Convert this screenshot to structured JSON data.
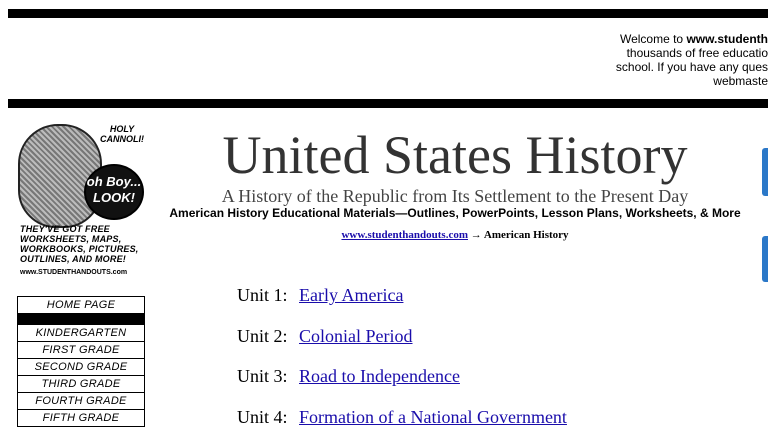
{
  "welcome": {
    "line1_prefix": "Welcome to ",
    "line1_bold": "www.studenth",
    "line2": "thousands of free educatio",
    "line3": "school. If you have any ques",
    "line4": "webmaste"
  },
  "mascot": {
    "exclaim": "HOLY CANNOLI!",
    "bubble": "oh Boy... LOOK!",
    "tagline": "THEY'VE GOT FREE WORKSHEETS, MAPS, WORKBOOKS, PICTURES, OUTLINES, AND MORE!",
    "site": "www.STUDENTHANDOUTS.com"
  },
  "nav": {
    "items": [
      "HOME PAGE",
      "",
      "KINDERGARTEN",
      "FIRST GRADE",
      "SECOND GRADE",
      "THIRD GRADE",
      "FOURTH GRADE",
      "FIFTH GRADE"
    ]
  },
  "header": {
    "title": "United States History",
    "subtitle": "A History of the Republic from Its Settlement to the Present Day",
    "tagline": "American History Educational Materials—Outlines, PowerPoints, Lesson Plans, Worksheets, & More"
  },
  "breadcrumb": {
    "link": "www.studenthandouts.com",
    "arrow": " → ",
    "current": "American History"
  },
  "units": [
    {
      "num": "Unit 1:",
      "title": "Early America"
    },
    {
      "num": "Unit 2:",
      "title": "Colonial Period"
    },
    {
      "num": "Unit 3:",
      "title": "Road to Independence"
    },
    {
      "num": "Unit 4:",
      "title": "Formation of a National Government"
    }
  ],
  "colors": {
    "link": "#1a0dab",
    "accent_tab": "#2b78c8"
  }
}
